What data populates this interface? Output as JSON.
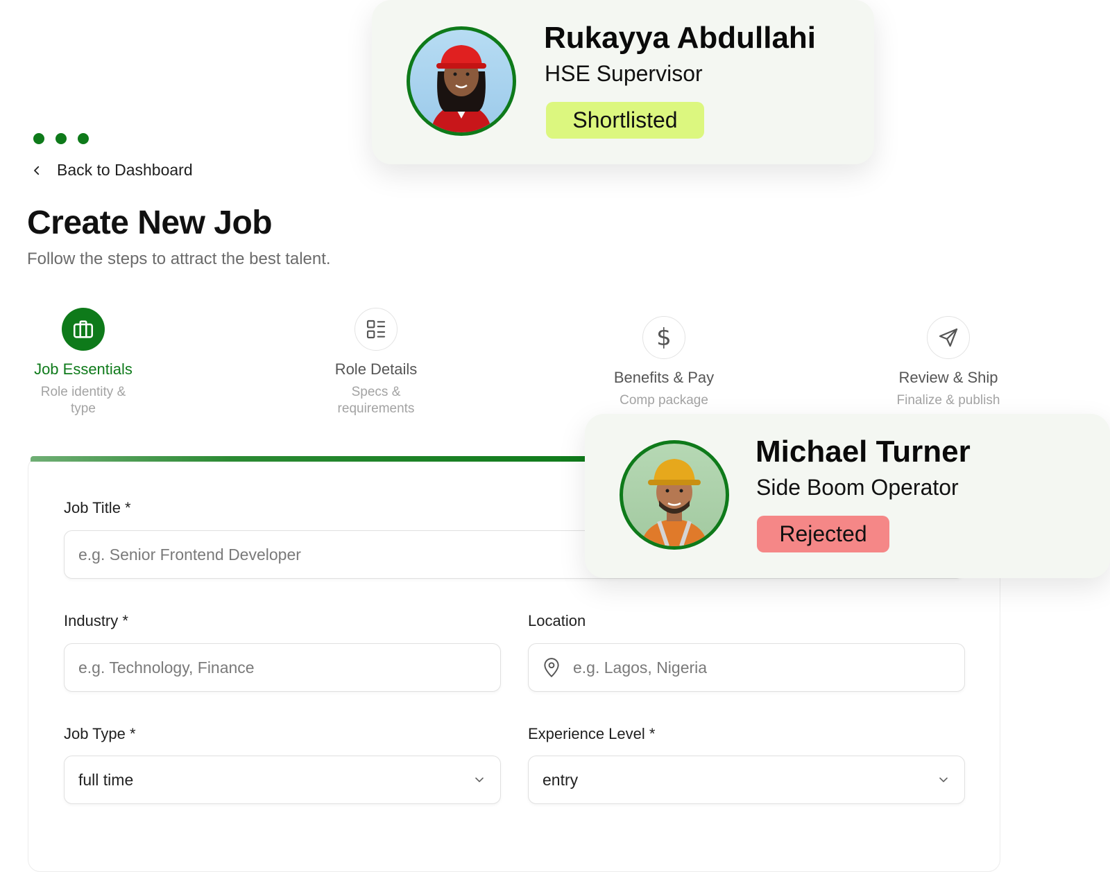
{
  "nav": {
    "back_label": "Back to Dashboard"
  },
  "header": {
    "title": "Create New Job",
    "subtitle": "Follow the steps to attract the best talent."
  },
  "steps": [
    {
      "label": "Job Essentials",
      "sub1": "Role identity &",
      "sub2": "type",
      "icon": "briefcase-icon",
      "active": true
    },
    {
      "label": "Role Details",
      "sub1": "Specs &",
      "sub2": "requirements",
      "icon": "list-icon",
      "active": false
    },
    {
      "label": "Benefits & Pay",
      "sub1": "Comp package",
      "sub2": "",
      "icon": "dollar-icon",
      "active": false
    },
    {
      "label": "Review & Ship",
      "sub1": "Finalize & publish",
      "sub2": "",
      "icon": "send-icon",
      "active": false
    }
  ],
  "form": {
    "job_title": {
      "label": "Job Title *",
      "placeholder": "e.g. Senior Frontend Developer"
    },
    "industry": {
      "label": "Industry *",
      "placeholder": "e.g. Technology, Finance"
    },
    "location": {
      "label": "Location",
      "placeholder": "e.g. Lagos, Nigeria"
    },
    "job_type": {
      "label": "Job Type *",
      "value": "full time"
    },
    "experience": {
      "label": "Experience Level *",
      "value": "entry"
    }
  },
  "candidates": [
    {
      "name": "Rukayya Abdullahi",
      "role": "HSE Supervisor",
      "status": "Shortlisted",
      "status_color": "#dcf77f"
    },
    {
      "name": "Michael Turner",
      "role": "Side Boom Operator",
      "status": "Rejected",
      "status_color": "#f58787"
    }
  ],
  "colors": {
    "accent": "#0e7a1a",
    "muted": "#a3a3a3"
  }
}
